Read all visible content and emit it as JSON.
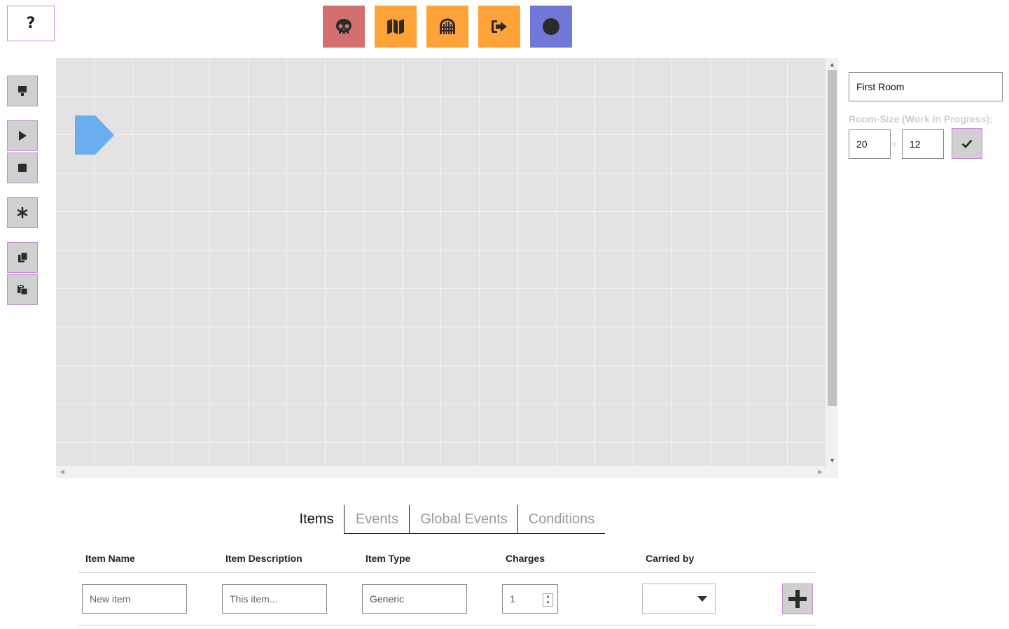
{
  "help": {
    "label": "?"
  },
  "toolbar": {
    "modes": [
      {
        "name": "skull-mode",
        "icon": "skull-icon",
        "color": "#d46f6f"
      },
      {
        "name": "map-mode",
        "icon": "map-icon",
        "color": "#ffa238"
      },
      {
        "name": "door-mode",
        "icon": "gate-icon",
        "color": "#ffa238"
      },
      {
        "name": "exit-mode",
        "icon": "exit-icon",
        "color": "#ffa238"
      },
      {
        "name": "circle-mode",
        "icon": "circle-icon",
        "color": "#7278d8"
      }
    ]
  },
  "side_toolbar": {
    "buttons": [
      "paint-icon",
      "play-icon",
      "stop-icon",
      "asterisk-icon",
      "copy-icon",
      "paste-icon"
    ]
  },
  "map": {
    "player_color": "#6aaef0",
    "columns": 20,
    "rows": 12
  },
  "room": {
    "name": "First Room",
    "size_label": "Room-Size (Work in Progress):",
    "width": "20",
    "separator": "x",
    "height": "12"
  },
  "tabs": [
    {
      "label": "Items",
      "active": true
    },
    {
      "label": "Events",
      "active": false
    },
    {
      "label": "Global Events",
      "active": false
    },
    {
      "label": "Conditions",
      "active": false
    }
  ],
  "items_table": {
    "headers": [
      "Item Name",
      "Item Description",
      "Item Type",
      "Charges",
      "Carried by"
    ],
    "new_row": {
      "name_placeholder": "New item",
      "description_placeholder": "This item...",
      "type_value": "Generic",
      "charges_value": "1",
      "carried_by_value": ""
    }
  }
}
